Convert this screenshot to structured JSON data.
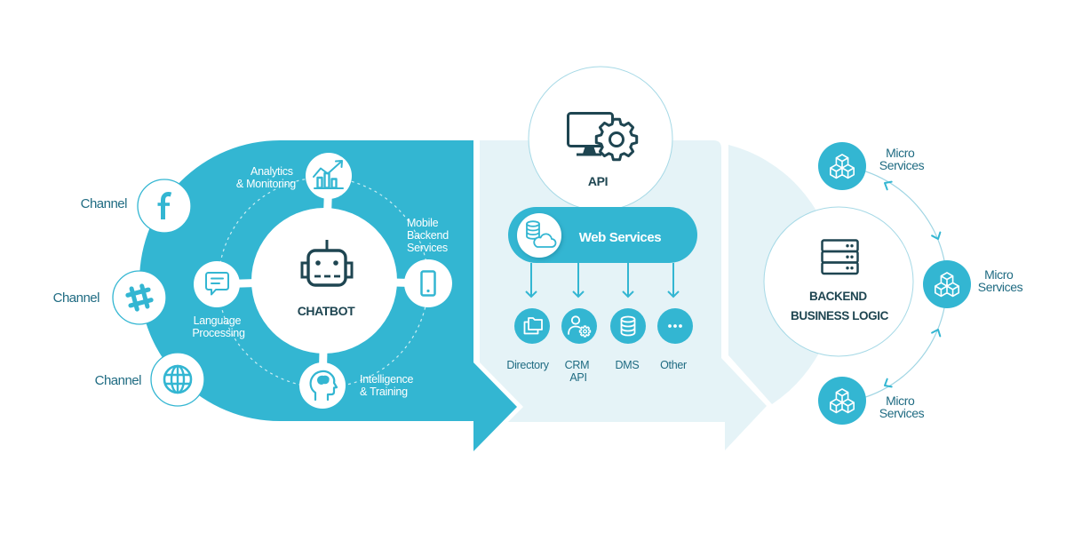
{
  "colors": {
    "primary_teal": "#33b6d2",
    "light_panel": "#e5f3f7",
    "dark_text": "#1e4551",
    "label_text": "#1f6b82"
  },
  "channels": [
    {
      "label": "Channel",
      "icon": "facebook-icon"
    },
    {
      "label": "Channel",
      "icon": "hashtag-icon"
    },
    {
      "label": "Channel",
      "icon": "globe-icon"
    }
  ],
  "chatbot": {
    "label": "CHATBOT",
    "icon": "robot-icon",
    "capabilities": [
      {
        "id": "analytics",
        "lines": [
          "Analytics",
          "& Monitoring"
        ],
        "icon": "analytics-chart-icon"
      },
      {
        "id": "mobile",
        "lines": [
          "Mobile",
          "Backend",
          "Services"
        ],
        "icon": "smartphone-icon"
      },
      {
        "id": "intelligence",
        "lines": [
          "Intelligence",
          "& Training"
        ],
        "icon": "head-brain-icon"
      },
      {
        "id": "language",
        "lines": [
          "Language",
          "Processing"
        ],
        "icon": "speech-bubble-icon"
      }
    ]
  },
  "api": {
    "label": "API",
    "icon": "monitor-gear-icon"
  },
  "web_services": {
    "label": "Web Services",
    "icon": "database-cloud-icon",
    "targets": [
      {
        "lines": [
          "Directory"
        ],
        "icon": "folders-icon"
      },
      {
        "lines": [
          "CRM",
          "API"
        ],
        "icon": "user-gear-icon"
      },
      {
        "lines": [
          "DMS"
        ],
        "icon": "database-icon"
      },
      {
        "lines": [
          "Other"
        ],
        "icon": "more-dots-icon"
      }
    ]
  },
  "backend": {
    "lines": [
      "BACKEND",
      "BUSINESS LOGIC"
    ],
    "icon": "server-stack-icon"
  },
  "micro_services": [
    {
      "lines": [
        "Micro",
        "Services"
      ],
      "icon": "cubes-icon"
    },
    {
      "lines": [
        "Micro",
        "Services"
      ],
      "icon": "cubes-icon"
    },
    {
      "lines": [
        "Micro",
        "Services"
      ],
      "icon": "cubes-icon"
    }
  ]
}
